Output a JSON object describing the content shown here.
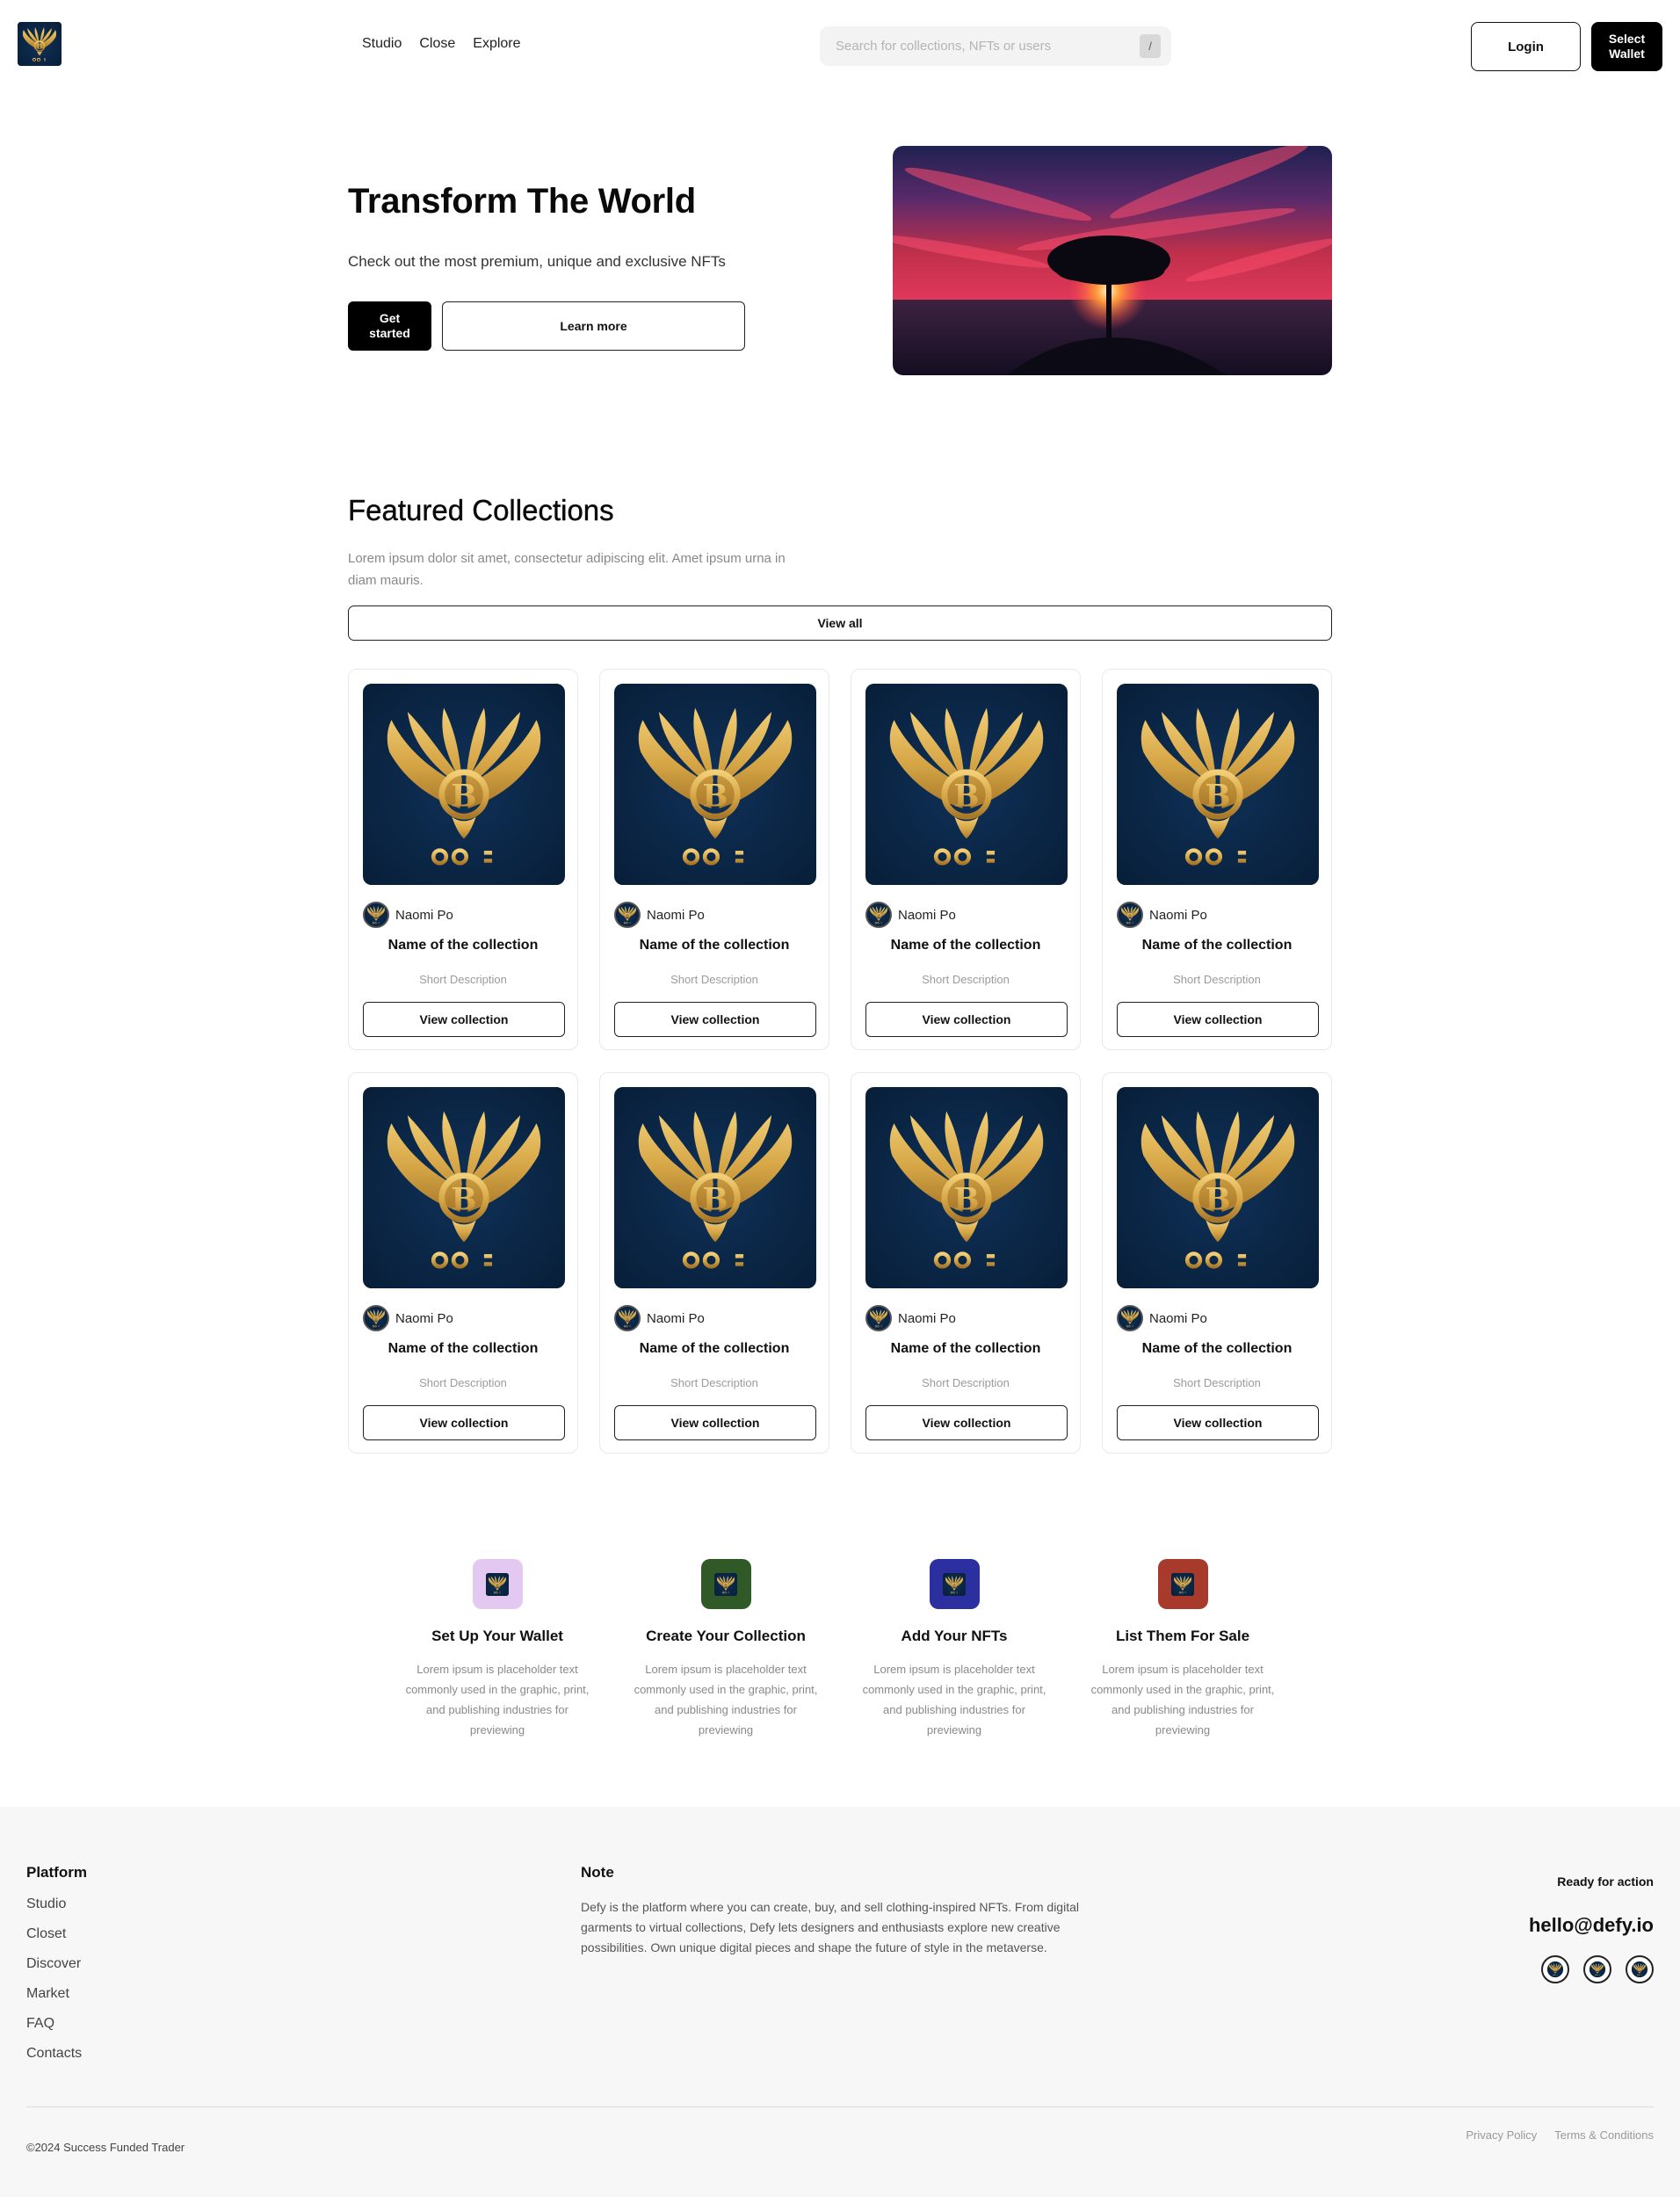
{
  "header": {
    "nav": [
      "Studio",
      "Close",
      "Explore"
    ],
    "search_placeholder": "Search for collections, NFTs or users",
    "search_shortcut": "/",
    "login_label": "Login",
    "wallet_label": "Select Wallet"
  },
  "hero": {
    "title": "Transform The World",
    "subtitle": "Check out the most premium, unique and exclusive NFTs",
    "primary_label": "Get started",
    "secondary_label": "Learn more"
  },
  "featured": {
    "title": "Featured Collections",
    "description": "Lorem ipsum dolor sit amet, consectetur adipiscing elit. Amet ipsum urna in diam mauris.",
    "view_all_label": "View all",
    "cards": [
      {
        "author": "Naomi Po",
        "name": "Name of the collection",
        "description": "Short Description",
        "button": "View collection"
      },
      {
        "author": "Naomi Po",
        "name": "Name of the collection",
        "description": "Short Description",
        "button": "View collection"
      },
      {
        "author": "Naomi Po",
        "name": "Name of the collection",
        "description": "Short Description",
        "button": "View collection"
      },
      {
        "author": "Naomi Po",
        "name": "Name of the collection",
        "description": "Short Description",
        "button": "View collection"
      },
      {
        "author": "Naomi Po",
        "name": "Name of the collection",
        "description": "Short Description",
        "button": "View collection"
      },
      {
        "author": "Naomi Po",
        "name": "Name of the collection",
        "description": "Short Description",
        "button": "View collection"
      },
      {
        "author": "Naomi Po",
        "name": "Name of the collection",
        "description": "Short Description",
        "button": "View collection"
      },
      {
        "author": "Naomi Po",
        "name": "Name of the collection",
        "description": "Short Description",
        "button": "View collection"
      }
    ]
  },
  "steps": [
    {
      "title": "Set Up Your Wallet",
      "text": "Lorem ipsum is placeholder text commonly used in the graphic, print, and publishing industries for previewing",
      "icon_bg": "#e3c9f2"
    },
    {
      "title": "Create Your Collection",
      "text": "Lorem ipsum is placeholder text commonly used in the graphic, print, and publishing industries for previewing",
      "icon_bg": "#2f5a28"
    },
    {
      "title": "Add Your NFTs",
      "text": "Lorem ipsum is placeholder text commonly used in the graphic, print, and publishing industries for previewing",
      "icon_bg": "#2b2fa0"
    },
    {
      "title": "List Them For Sale",
      "text": "Lorem ipsum is placeholder text commonly used in the graphic, print, and publishing industries for previewing",
      "icon_bg": "#a73a2b"
    }
  ],
  "footer": {
    "platform_title": "Platform",
    "links": [
      "Studio",
      "Closet",
      "Discover",
      "Market",
      "FAQ",
      "Contacts"
    ],
    "note_title": "Note",
    "note_text": "Defy is the platform where you can create, buy, and sell clothing-inspired NFTs. From digital garments to virtual collections, Defy lets designers and enthusiasts explore new creative possibilities. Own unique digital pieces and shape the future of style in the metaverse.",
    "ready_label": "Ready for action",
    "email": "hello@defy.io",
    "copyright": "©2024 Success Funded Trader",
    "legal": [
      "Privacy Policy",
      "Terms & Conditions"
    ]
  },
  "colors": {
    "brand_navy": "#0b2746",
    "gold": "#d9a94a",
    "primary_button": "#000000"
  },
  "icons": {
    "logo": "winged-b-emblem-logo",
    "social": [
      "social-icon",
      "social-icon",
      "social-icon"
    ]
  }
}
